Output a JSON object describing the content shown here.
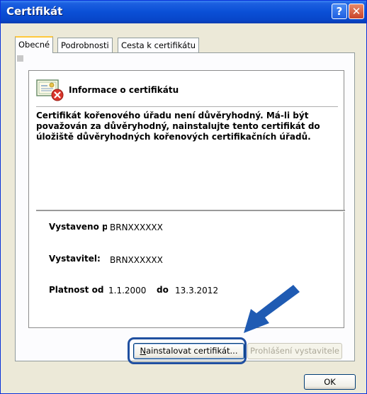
{
  "window": {
    "title": "Certifikát",
    "help_glyph": "?",
    "close_glyph": "✕"
  },
  "tabs": [
    {
      "label": "Obecné",
      "active": true
    },
    {
      "label": "Podrobnosti",
      "active": false
    },
    {
      "label": "Cesta k certifikátu",
      "active": false
    }
  ],
  "info": {
    "title": "Informace o certifikátu",
    "warning": "Certifikát kořenového úřadu není důvěryhodný. Má-li být považován za důvěryhodný, nainstalujte tento certifikát do úložiště důvěryhodných kořenových certifikačních úřadů.",
    "issued_to_label": "Vystaveno pro",
    "issued_to_value": "BRNXXXXXX",
    "issuer_label": "Vystavitel:",
    "issuer_value": "BRNXXXXXX",
    "validity_label": "Platnost od",
    "validity_from": "1.1.2000",
    "validity_to_label": "do",
    "validity_to": "13.3.2012"
  },
  "buttons": {
    "install_prefix": "N",
    "install_rest": "ainstalovat certifikát...",
    "publisher_statement": "Prohlášení vystavitele",
    "ok": "OK"
  },
  "colors": {
    "titlebar": "#0a4fd6",
    "annotation_arrow": "#1f5bb3",
    "tab_highlight": "#ffc83c"
  },
  "icons": [
    "certificate-icon",
    "error-x-icon",
    "help-icon",
    "close-icon",
    "annotation-arrow-icon"
  ]
}
